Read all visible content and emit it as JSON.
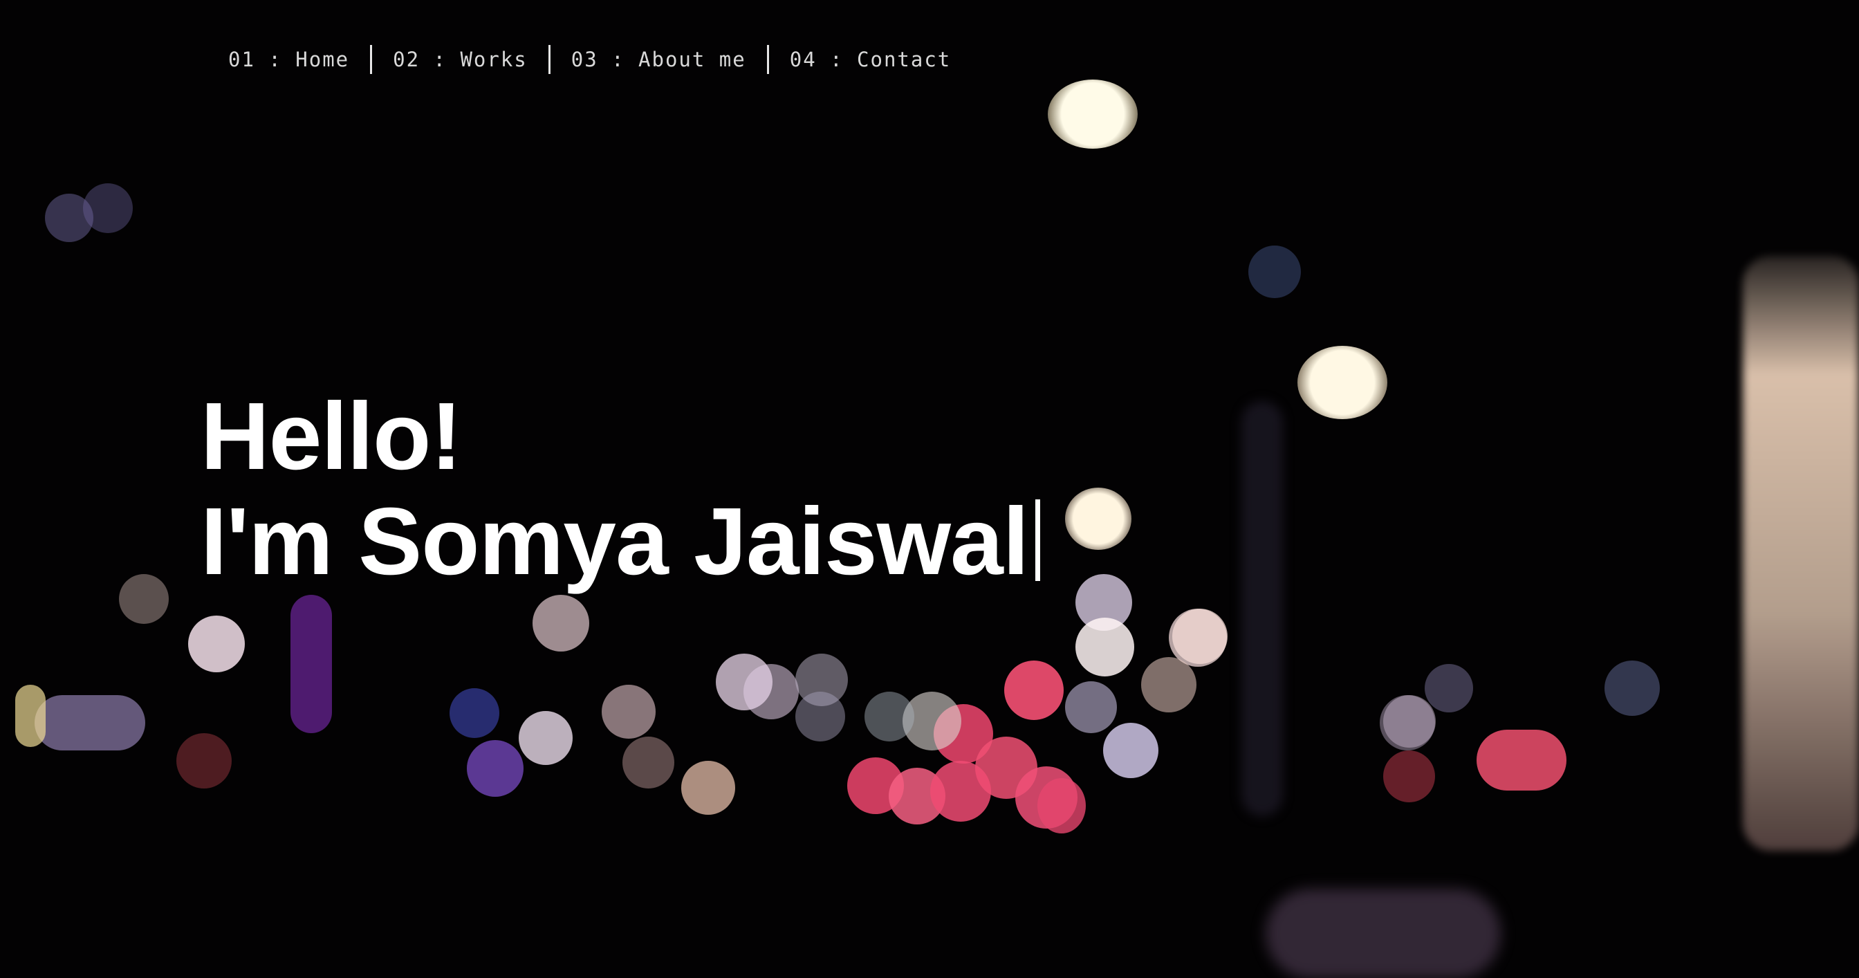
{
  "nav": {
    "items": [
      {
        "label": "01 : Home"
      },
      {
        "label": "02 : Works"
      },
      {
        "label": "03 : About me"
      },
      {
        "label": "04 : Contact"
      }
    ]
  },
  "hero": {
    "greeting": "Hello!",
    "intro": "I'm Somya Jaiswal"
  },
  "background": {
    "description_color": "#030203",
    "bokeh_colors": [
      "#fff4dc",
      "#f04a6e",
      "#c9b4e6",
      "#e6c2b0",
      "#6f3bd0",
      "#5a6fd8"
    ]
  }
}
